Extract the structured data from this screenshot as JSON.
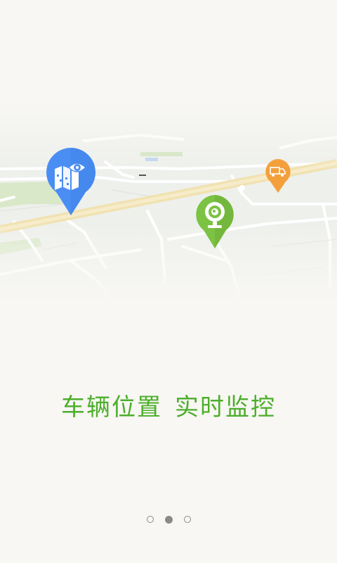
{
  "slogan": {
    "part1": "车辆位置",
    "part2": "实时监控"
  },
  "pager": {
    "count": 3,
    "active_index": 1
  },
  "colors": {
    "background": "#f8f7f3",
    "slogan_green": "#4cae2b",
    "pin_blue": "#4b8ef3",
    "pin_green": "#7cc243",
    "pin_orange": "#f3a03c",
    "highway": "#f3e3b4"
  },
  "icons": {
    "map_pin": "map-view-pin-icon",
    "camera_pin": "webcam-pin-icon",
    "truck_pin": "truck-pin-icon"
  }
}
